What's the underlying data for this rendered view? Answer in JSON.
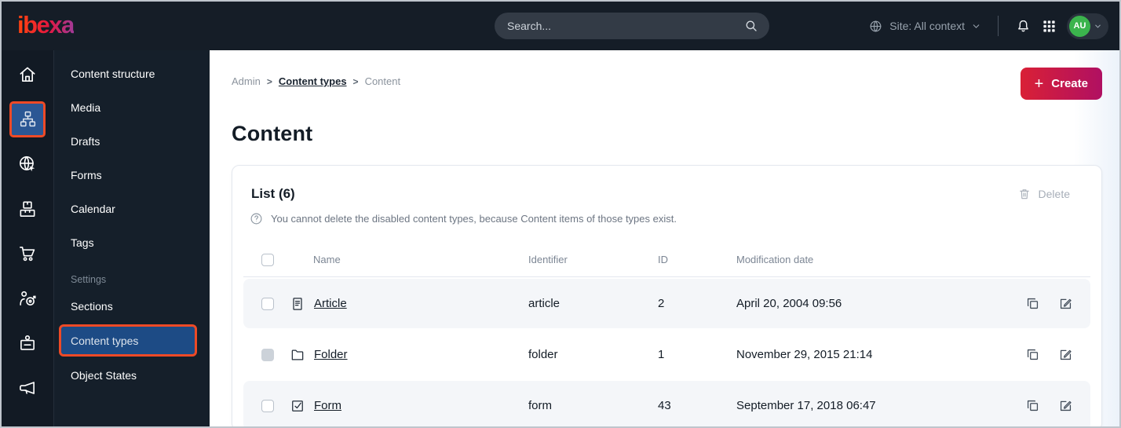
{
  "topbar": {
    "logo_text": "ibexa",
    "search_placeholder": "Search...",
    "site_label": "Site: All context",
    "avatar_initials": "AU"
  },
  "icon_rail": {
    "icons": [
      "home",
      "content-structure",
      "site",
      "product-catalog",
      "commerce",
      "personalization",
      "admin",
      "marketing"
    ],
    "active_icon": "content-structure"
  },
  "sidebar": {
    "items": [
      {
        "label": "Content structure"
      },
      {
        "label": "Media"
      },
      {
        "label": "Drafts"
      },
      {
        "label": "Forms"
      },
      {
        "label": "Calendar"
      },
      {
        "label": "Tags"
      }
    ],
    "settings_label": "Settings",
    "settings_items": [
      {
        "label": "Sections"
      },
      {
        "label": "Content types",
        "active": true
      },
      {
        "label": "Object States"
      }
    ]
  },
  "breadcrumb": {
    "items": [
      "Admin",
      "Content types",
      "Content"
    ]
  },
  "page": {
    "title": "Content",
    "create_label": "Create"
  },
  "card": {
    "list_title": "List (6)",
    "notice": "You cannot delete the disabled content types, because Content items of those types exist.",
    "delete_label": "Delete"
  },
  "table": {
    "headers": {
      "name": "Name",
      "identifier": "Identifier",
      "id": "ID",
      "modified": "Modification date"
    },
    "rows": [
      {
        "name": "Article",
        "icon": "article-icon",
        "identifier": "article",
        "id": "2",
        "modified": "April 20, 2004 09:56",
        "checkbox_disabled": false
      },
      {
        "name": "Folder",
        "icon": "folder-icon",
        "identifier": "folder",
        "id": "1",
        "modified": "November 29, 2015 21:14",
        "checkbox_disabled": true
      },
      {
        "name": "Form",
        "icon": "form-icon",
        "identifier": "form",
        "id": "43",
        "modified": "September 17, 2018 06:47",
        "checkbox_disabled": false
      }
    ]
  },
  "colors": {
    "topbar_bg": "#151d27",
    "sidebar_bg": "#151f2a",
    "active_blue": "#1d4b85",
    "highlight_orange": "#ee4a26",
    "brand_gradient_start": "#ff4112",
    "brand_gradient_end": "#a03a98",
    "create_gradient_start": "#d92036",
    "create_gradient_end": "#b01062",
    "avatar_green": "#3bb44d",
    "row_stripe": "#f4f6f9"
  }
}
